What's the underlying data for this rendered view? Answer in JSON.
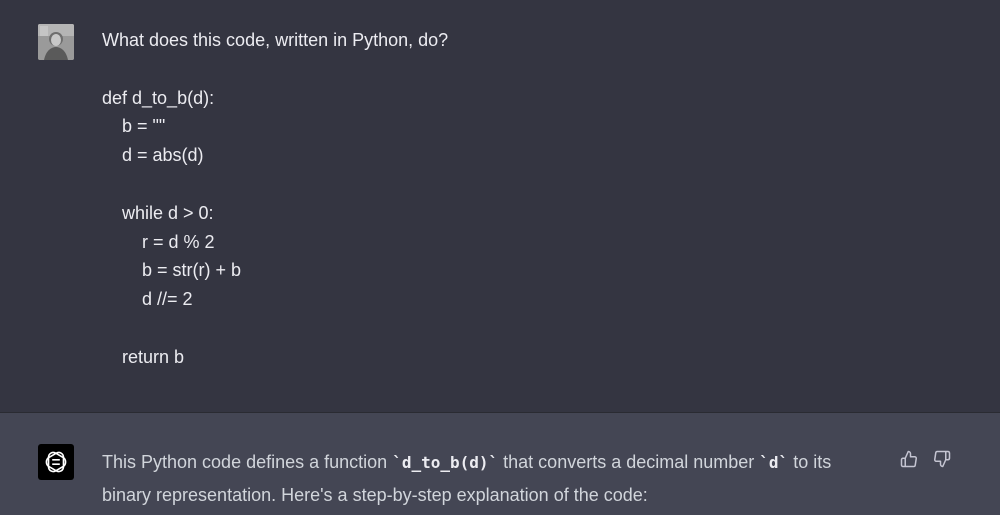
{
  "user_message": {
    "question": "What does this code, written in Python, do?",
    "code": {
      "line1": "def d_to_b(d):",
      "line2": "b = \"\"",
      "line3": "d = abs(d)",
      "line4": "while d > 0:",
      "line5": "r = d % 2",
      "line6": "b = str(r) + b",
      "line7": "d //= 2",
      "line8": "return b"
    }
  },
  "assistant_message": {
    "part1": "This Python code defines a function ",
    "code1": "`d_to_b(d)`",
    "part2": " that converts a decimal number ",
    "code2": "`d`",
    "part3": " to its binary representation. Here's a step-by-step explanation of the code:"
  },
  "icons": {
    "user_avatar": "user-avatar-photo",
    "assistant_logo": "openai-logo-icon",
    "thumbs_up": "thumbs-up-icon",
    "thumbs_down": "thumbs-down-icon"
  },
  "colors": {
    "user_bg": "#343541",
    "assistant_bg": "#444654",
    "text": "#ececf1"
  }
}
